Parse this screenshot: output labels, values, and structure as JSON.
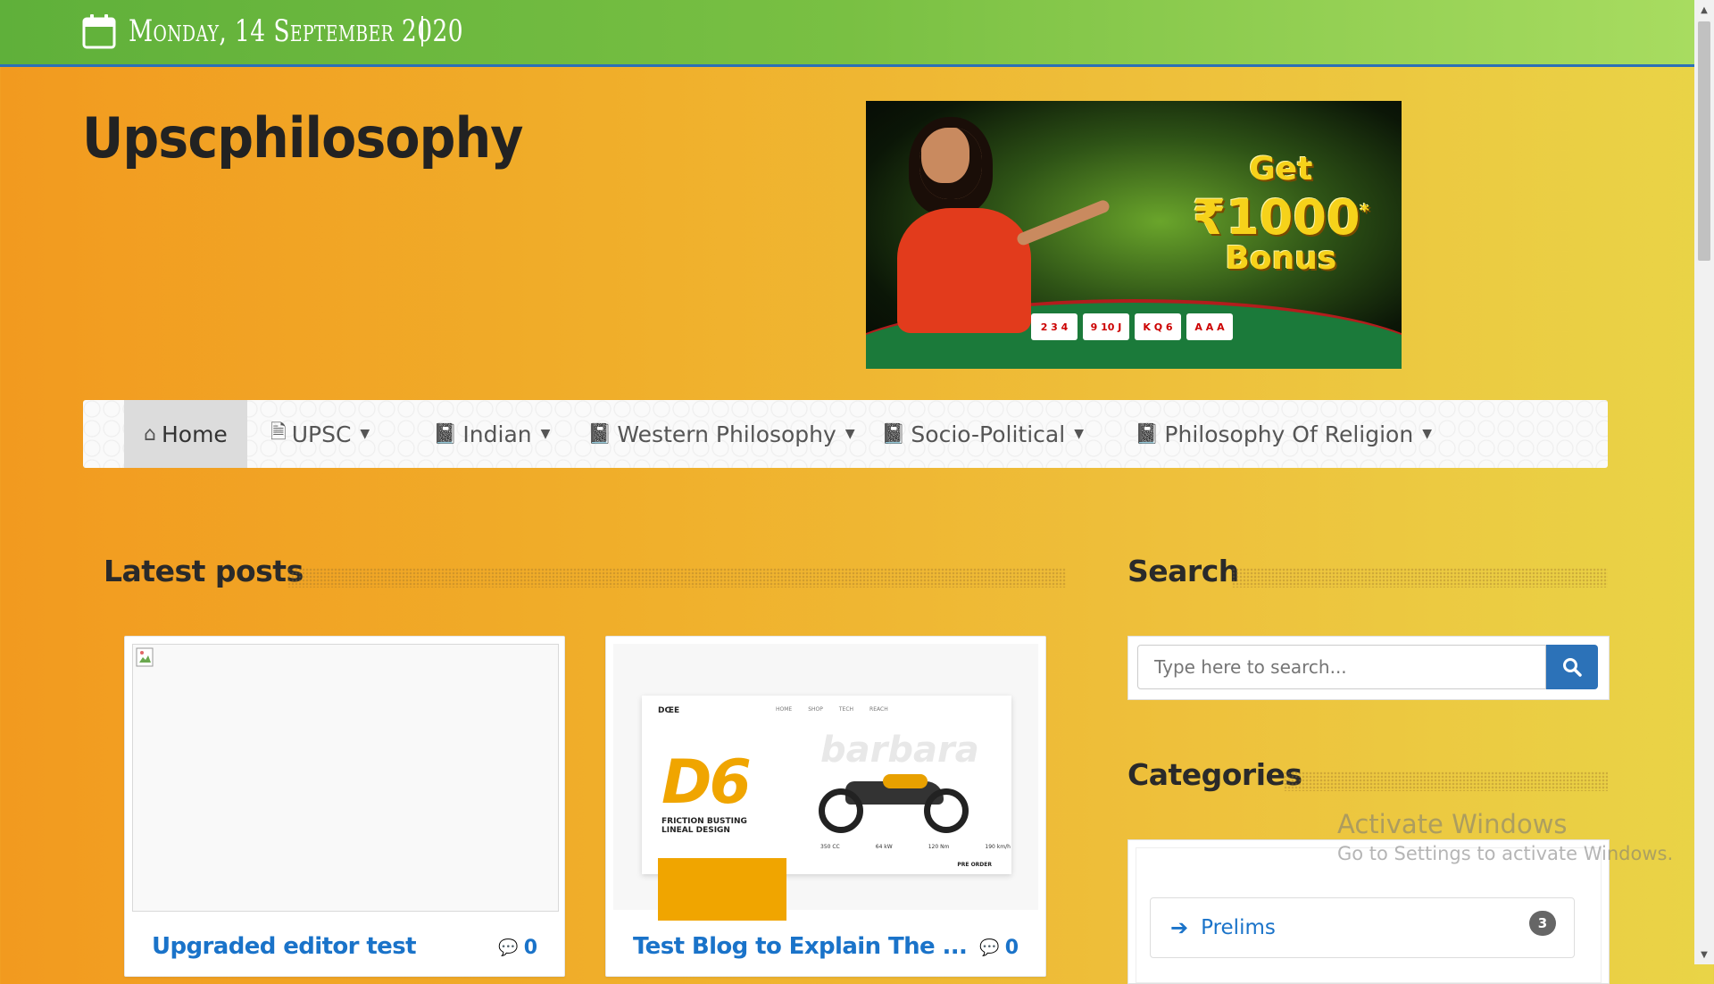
{
  "topbar": {
    "date": "Monday, 14 September 2020",
    "icon": "calendar-icon",
    "bg_color": "#79c043",
    "border_color": "#2c6fb6"
  },
  "site": {
    "title": "Upscphilosophy"
  },
  "banner": {
    "line1": "Get",
    "line2": "₹1000",
    "line2_star": "*",
    "line3": "Bonus",
    "cards": [
      "2 3 4",
      "9 10 J",
      "K Q 6",
      "A A A"
    ]
  },
  "nav": {
    "items": [
      {
        "label": "Home",
        "icon": "home-icon",
        "active": true
      },
      {
        "label": "UPSC",
        "icon": "document-icon",
        "dropdown": true
      },
      {
        "label": "Indian",
        "icon": "book-icon",
        "dropdown": true
      },
      {
        "label": "Western Philosophy",
        "icon": "book-icon",
        "dropdown": true
      },
      {
        "label": "Socio-Political",
        "icon": "book-icon",
        "dropdown": true
      },
      {
        "label": "Philosophy Of Religion",
        "icon": "book-icon",
        "dropdown": true
      }
    ]
  },
  "latest": {
    "heading": "Latest posts",
    "posts": [
      {
        "title": "Upgraded editor test",
        "comments": "0"
      },
      {
        "title": "Test Blog to Explain The ...",
        "comments": "0",
        "thumb": {
          "logo": "DŒE",
          "menu": [
            "HOME",
            "SHOP",
            "TECH",
            "REACH"
          ],
          "big": "D6",
          "tag1": "FRICTION BUSTING",
          "tag2": "LINEAL DESIGN",
          "brand": "barbara",
          "stats": [
            "350 CC",
            "64 kW",
            "120 Nm",
            "190 km/h"
          ],
          "cta": "PRE ORDER"
        }
      }
    ]
  },
  "sidebar": {
    "search_heading": "Search",
    "search_placeholder": "Type here to search...",
    "categories_heading": "Categories",
    "categories": [
      {
        "label": "Prelims",
        "count": "3"
      }
    ]
  },
  "watermark": {
    "line1": "Activate Windows",
    "line2": "Go to Settings to activate Windows."
  },
  "colors": {
    "link": "#1a73c9",
    "search_button": "#2c72b8",
    "bg_start": "#f29a1f",
    "bg_end": "#e9d447"
  }
}
